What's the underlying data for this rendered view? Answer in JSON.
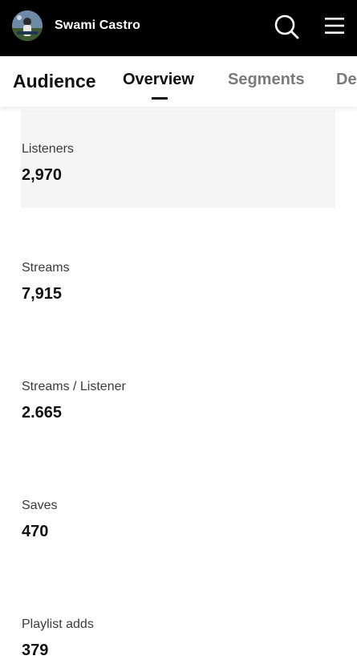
{
  "header": {
    "user_name": "Swami Castro",
    "avatar_icon": "user-avatar",
    "search_icon": "search-icon",
    "menu_icon": "hamburger-menu-icon",
    "background": "#000000"
  },
  "subnav": {
    "title": "Audience",
    "tabs": [
      {
        "label": "Overview",
        "active": true
      },
      {
        "label": "Segments",
        "active": false
      },
      {
        "label": "De",
        "active": false
      }
    ]
  },
  "metrics": [
    {
      "label": "Listeners",
      "value": "2,970",
      "highlighted": true
    },
    {
      "label": "Streams",
      "value": "7,915",
      "highlighted": false
    },
    {
      "label": "Streams / Listener",
      "value": "2.665",
      "highlighted": false
    },
    {
      "label": "Saves",
      "value": "470",
      "highlighted": false
    },
    {
      "label": "Playlist adds",
      "value": "379",
      "highlighted": false
    }
  ]
}
